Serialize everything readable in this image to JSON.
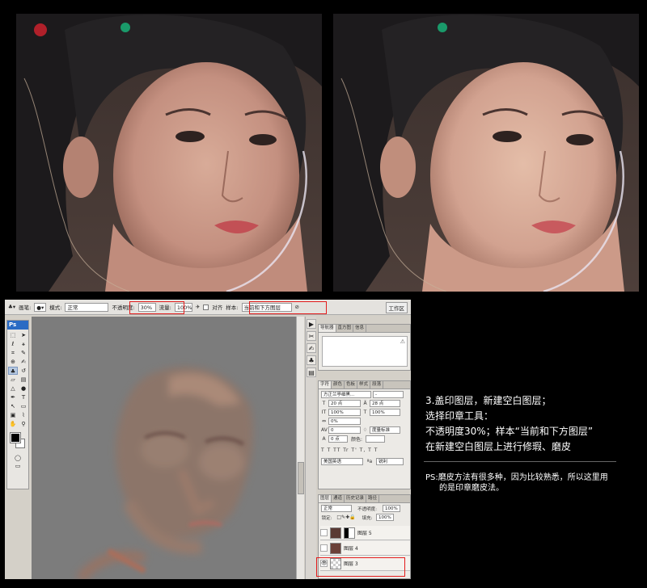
{
  "photos": {
    "before": {
      "alt": "before retouch"
    },
    "after": {
      "alt": "after retouch"
    }
  },
  "options_bar": {
    "brush_label": "画笔:",
    "mode_label": "模式:",
    "mode_value": "正常",
    "opacity_label": "不透明度:",
    "opacity_value": "30%",
    "flow_label": "流量:",
    "flow_value": "100%",
    "align_label": "对齐",
    "sample_label": "样本:",
    "sample_value": "当前和下方图层",
    "workspace_label": "工作区"
  },
  "toolbox": {
    "logo": "Ps"
  },
  "panels": {
    "nav_tabs": [
      "导航器",
      "直方图",
      "信息"
    ],
    "char_tabs": [
      "字符",
      "颜色",
      "色板",
      "样式",
      "段落"
    ],
    "font_family": "方正兰亭细黑...",
    "font_style": "-",
    "font_size": "20 点",
    "leading": "28 点",
    "vscale": "100%",
    "hscale": "100%",
    "tracking": "0%",
    "kerning": "0",
    "kerning_mode": "度量标准",
    "baseline": "0 点",
    "color_label": "颜色:",
    "type_buttons": "T T TT Tr T' T, T T",
    "language": "美国英语",
    "aa_label": "ªa",
    "aa_value": "锐利",
    "layer_tabs": [
      "图层",
      "通道",
      "历史记录",
      "路径"
    ],
    "blend_mode": "正常",
    "layer_opacity_label": "不透明度:",
    "layer_opacity_value": "100%",
    "lock_label": "锁定:",
    "fill_label": "填充:",
    "fill_value": "100%",
    "layers": [
      {
        "name": "图层 5"
      },
      {
        "name": "图层 4"
      },
      {
        "name": "图层 3"
      }
    ]
  },
  "caption": {
    "line1": "3.盖印图层，新建空白图层；",
    "line2": "选择印章工具：",
    "line3": "不透明度30%；样本“当前和下方图层”",
    "line4": "在新建空白图层上进行修瑕、磨皮"
  },
  "ps_note": {
    "line1": "PS:磨皮方法有很多种，因为比较熟悉，所以这里用",
    "line2": "的是印章磨皮法。"
  },
  "colors": {
    "highlight": "#e31b1b",
    "canvas": "#7c7c7c",
    "ps_blue": "#2a6bc4"
  }
}
